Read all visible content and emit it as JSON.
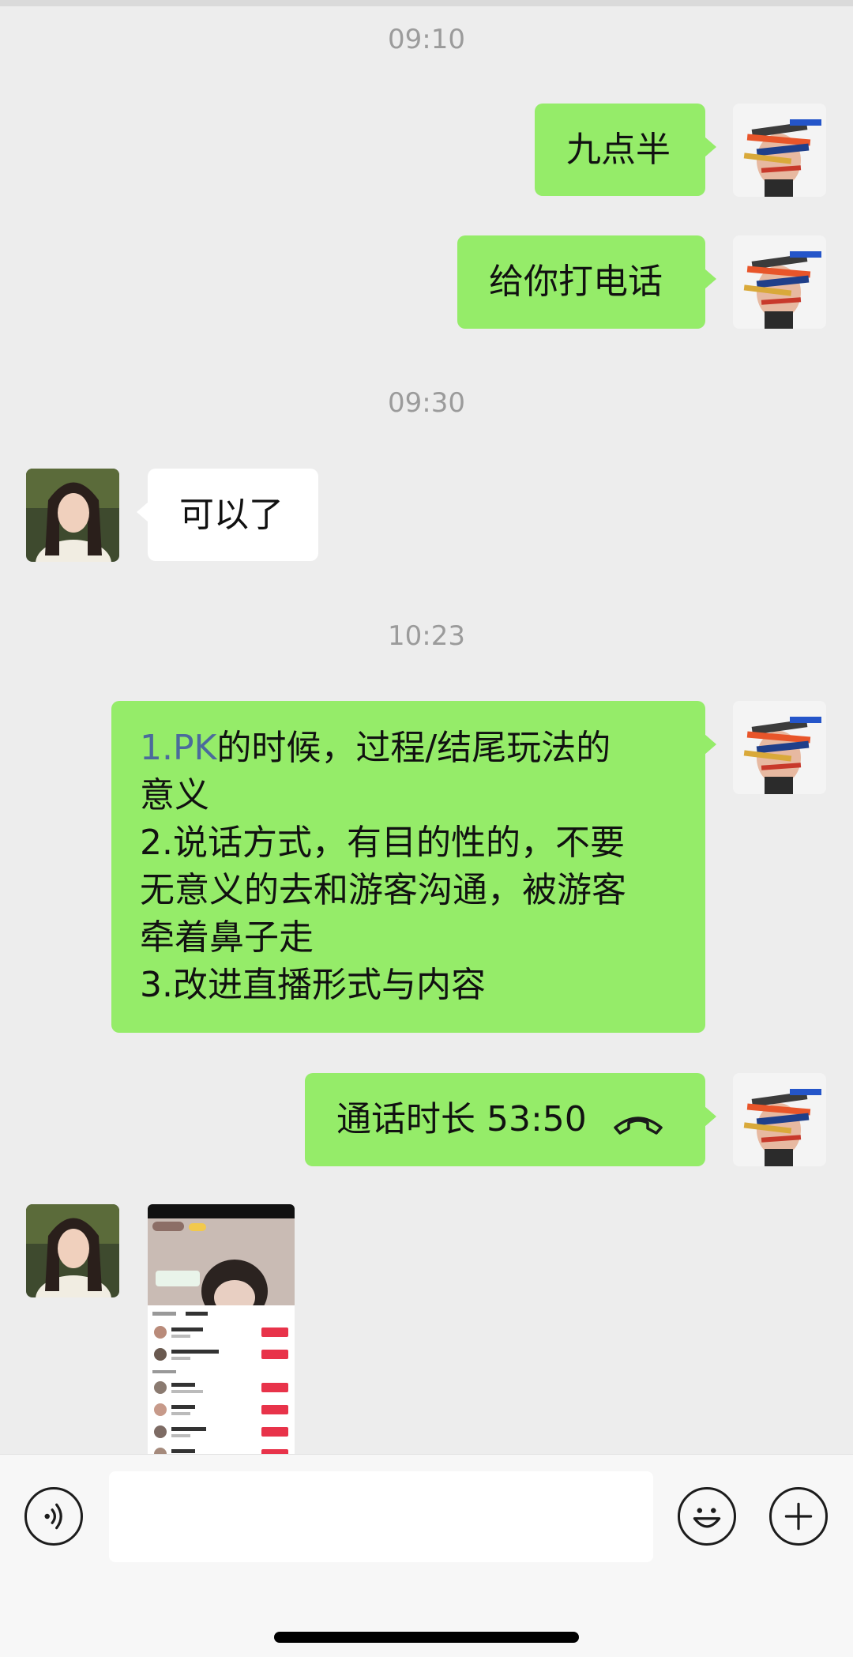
{
  "messages": {
    "ts1": "09:10",
    "m1": "九点半",
    "m2": "给你打电话",
    "ts2": "09:30",
    "m3": "可以了",
    "ts3": "10:23",
    "m4": {
      "lines": [
        {
          "prefix": "1.PK",
          "text": "的时候，过程/结尾玩法的"
        },
        {
          "prefix": "",
          "text": "意义"
        },
        {
          "prefix": "",
          "text": "2.说话方式，有目的性的，不要"
        },
        {
          "prefix": "",
          "text": "无意义的去和游客沟通，被游客"
        },
        {
          "prefix": "",
          "text": "牵着鼻子走"
        },
        {
          "prefix": "",
          "text": "3.改进直播形式与内容"
        }
      ]
    },
    "call": {
      "label": "通话时长 53:50",
      "icon": "phone-hangup-icon"
    }
  },
  "screenshot_thumb": {
    "status_time": "23:06",
    "tabs": [
      "好友PK",
      "随机PK"
    ],
    "rows": [
      {
        "name": "Hai哥",
        "btn": "邀请PK"
      },
      {
        "name": "张家不要矿啊哥",
        "btn": "邀请PK"
      },
      {
        "name": "沐沐",
        "btn": "邀请PK"
      },
      {
        "name": "婉婉",
        "btn": "邀请PK"
      },
      {
        "name": "晓晓小花仙",
        "btn": "邀请PK"
      }
    ]
  },
  "input_bar": {
    "voice_icon": "voice-icon",
    "emoji_icon": "emoji-icon",
    "plus_icon": "plus-icon"
  },
  "colors": {
    "my_bubble": "#95ec69",
    "their_bubble": "#ffffff",
    "background": "#ededed",
    "timestamp": "#9b9b9b",
    "accent_prefix": "#4b6a9c",
    "pk_button": "#e8334a"
  }
}
